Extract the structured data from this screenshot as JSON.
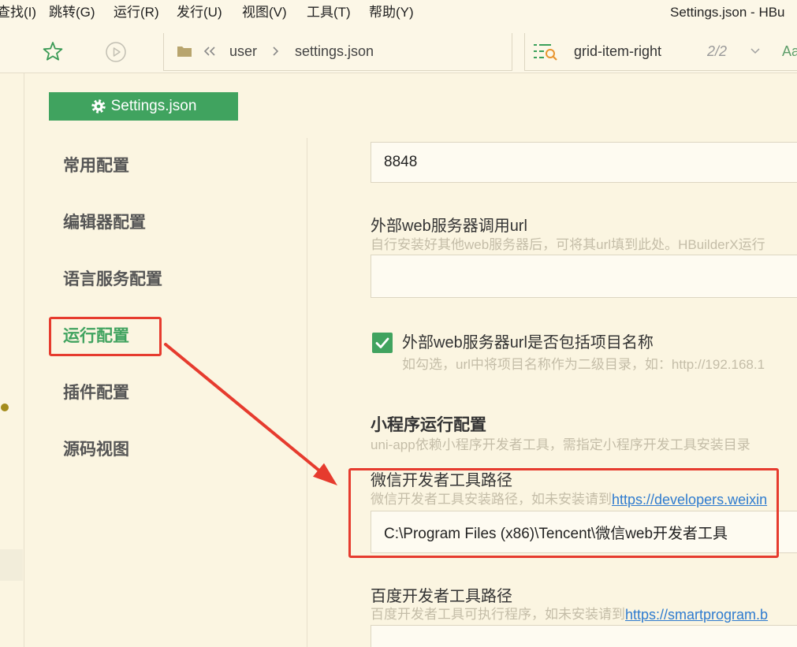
{
  "window": {
    "title": "Settings.json - HBu"
  },
  "menu": {
    "items": [
      {
        "label": "查找(I)"
      },
      {
        "label": "跳转(G)"
      },
      {
        "label": "运行(R)"
      },
      {
        "label": "发行(U)"
      },
      {
        "label": "视图(V)"
      },
      {
        "label": "工具(T)"
      },
      {
        "label": "帮助(Y)"
      }
    ]
  },
  "toolbar": {
    "favorite_icon": "star-icon",
    "run_icon": "play-circle-icon",
    "breadcrumb": {
      "folder_icon": "folder-icon",
      "back_icon": "double-chevron-left-icon",
      "separator_icon": "chevron-right-icon",
      "items": [
        "user",
        "settings.json"
      ]
    },
    "find": {
      "icon": "list-search-icon",
      "query": "grid-item-right",
      "match_count": "2/2",
      "dropdown_icon": "chevron-down-icon",
      "match_case_label": "Aa"
    }
  },
  "settings": {
    "header": {
      "icon": "gear-icon",
      "title": "Settings.json"
    },
    "nav": {
      "items": [
        {
          "label": "常用配置",
          "active": false
        },
        {
          "label": "编辑器配置",
          "active": false
        },
        {
          "label": "语言服务配置",
          "active": false
        },
        {
          "label": "运行配置",
          "active": true
        },
        {
          "label": "插件配置",
          "active": false
        },
        {
          "label": "源码视图",
          "active": false
        }
      ]
    },
    "fields": {
      "port": {
        "value": "8848"
      },
      "external_server_url": {
        "label": "外部web服务器调用url",
        "description": "自行安装好其他web服务器后，可将其url填到此处。HBuilderX运行",
        "value": ""
      },
      "include_project_name": {
        "label": "外部web服务器url是否包括项目名称",
        "description": "如勾选，url中将项目名称作为二级目录，如：http://192.168.1",
        "checked": true
      },
      "miniprogram_section": {
        "title": "小程序运行配置",
        "description": "uni-app依赖小程序开发者工具，需指定小程序开发工具安装目录"
      },
      "wechat_devtools_path": {
        "label": "微信开发者工具路径",
        "description": "微信开发者工具安装路径，如未安装请到",
        "link": "https://developers.weixin",
        "value": "C:\\Program Files (x86)\\Tencent\\微信web开发者工具"
      },
      "baidu_devtools_path": {
        "label": "百度开发者工具路径",
        "description": "百度开发者工具可执行程序，如未安装请到",
        "link": "https://smartprogram.b",
        "value": ""
      }
    }
  },
  "colors": {
    "accent": "#40a35f",
    "highlight": "#e63b2e",
    "link": "#2e7bcf",
    "background": "#fbf5e1"
  }
}
